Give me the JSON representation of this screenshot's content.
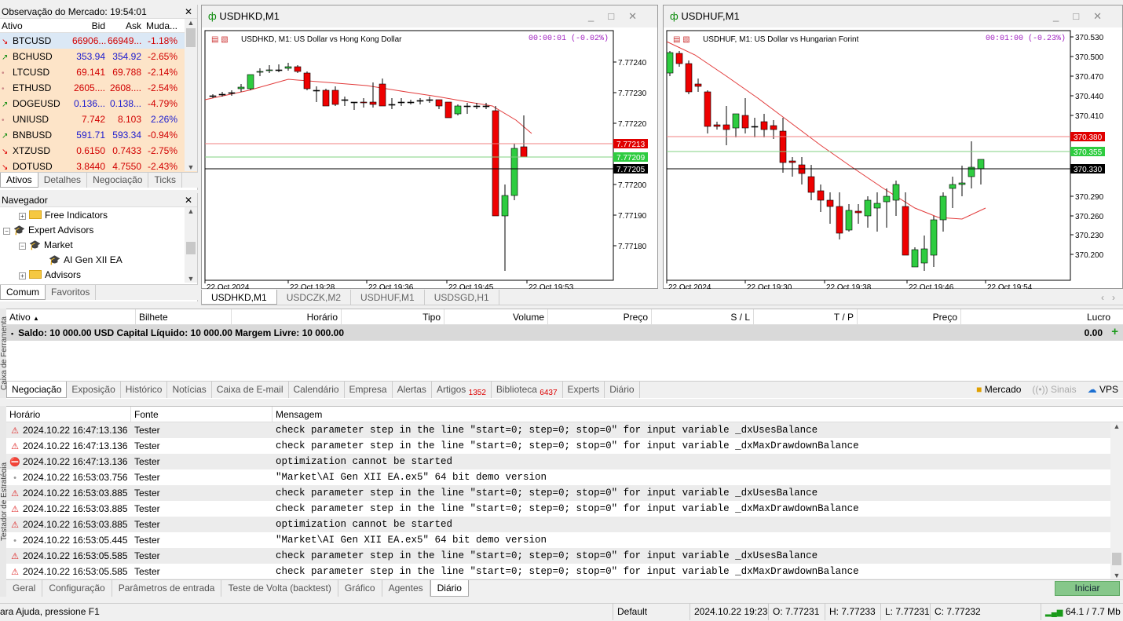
{
  "market_watch": {
    "title": "Observação do Mercado: 19:54:01",
    "headers": [
      "Ativo",
      "Bid",
      "Ask",
      "Muda..."
    ],
    "rows": [
      {
        "sym": "BTCUSD",
        "bid": "66906...",
        "ask": "66949...",
        "chg": "-1.18%",
        "dir": "dn"
      },
      {
        "sym": "BCHUSD",
        "bid": "353.94",
        "ask": "354.92",
        "chg": "-2.65%",
        "dir": "up"
      },
      {
        "sym": "LTCUSD",
        "bid": "69.141",
        "ask": "69.788",
        "chg": "-2.14%",
        "dir": "dot"
      },
      {
        "sym": "ETHUSD",
        "bid": "2605....",
        "ask": "2608....",
        "chg": "-2.54%",
        "dir": "dot"
      },
      {
        "sym": "DOGEUSD",
        "bid": "0.136...",
        "ask": "0.138...",
        "chg": "-4.79%",
        "dir": "up"
      },
      {
        "sym": "UNIUSD",
        "bid": "7.742",
        "ask": "8.103",
        "chg": "2.26%",
        "dir": "dot"
      },
      {
        "sym": "BNBUSD",
        "bid": "591.71",
        "ask": "593.34",
        "chg": "-0.94%",
        "dir": "up"
      },
      {
        "sym": "XTZUSD",
        "bid": "0.6150",
        "ask": "0.7433",
        "chg": "-2.75%",
        "dir": "dn"
      },
      {
        "sym": "DOTUSD",
        "bid": "3.8440",
        "ask": "4.7550",
        "chg": "-2.43%",
        "dir": "dn"
      }
    ],
    "tabs": [
      "Ativos",
      "Detalhes",
      "Negociação",
      "Ticks"
    ]
  },
  "navigator": {
    "title": "Navegador",
    "items": [
      "Free Indicators",
      "Expert Advisors",
      "Market",
      "AI Gen XII EA",
      "Advisors"
    ],
    "tabs": [
      "Comum",
      "Favoritos"
    ]
  },
  "chart1": {
    "title": "USDHKD,M1",
    "subtitle": "USDHKD, M1:  US Dollar vs Hong Kong Dollar",
    "timer": "00:00:01 (-0.02%)",
    "prices": [
      "7.77240",
      "7.77230",
      "7.77220",
      "7.77200",
      "7.77190",
      "7.77180"
    ],
    "lines": {
      "ask": "7.77213",
      "bid": "7.77209",
      "last": "7.77205"
    },
    "times": [
      "22 Oct 2024",
      "22 Oct 19:28",
      "22 Oct 19:36",
      "22 Oct 19:45",
      "22 Oct 19:53"
    ]
  },
  "chart2": {
    "title": "USDHUF,M1",
    "subtitle": "USDHUF, M1:  US Dollar vs Hungarian Forint",
    "timer": "00:01:00 (-0.23%)",
    "prices": [
      "370.530",
      "370.500",
      "370.470",
      "370.440",
      "370.410",
      "370.290",
      "370.260",
      "370.230",
      "370.200"
    ],
    "lines": {
      "ask": "370.380",
      "bid": "370.355",
      "last": "370.330"
    },
    "times": [
      "22 Oct 2024",
      "22 Oct 19:30",
      "22 Oct 19:38",
      "22 Oct 19:46",
      "22 Oct 19:54"
    ]
  },
  "chart_tabs": [
    "USDHKD,M1",
    "USDCZK,M2",
    "USDHUF,M1",
    "USDSGD,H1"
  ],
  "trade": {
    "headers": [
      "Ativo",
      "Bilhete",
      "Horário",
      "Tipo",
      "Volume",
      "Preço",
      "S / L",
      "T / P",
      "Preço",
      "Lucro"
    ],
    "balance": "Saldo: 10 000.00 USD  Capital Líquido: 10 000.00  Margem Livre: 10 000.00",
    "profit": "0.00",
    "side_label": "Caixa de Ferramenta"
  },
  "toolbox_tabs": {
    "items": [
      "Negociação",
      "Exposição",
      "Histórico",
      "Notícias",
      "Caixa de E-mail",
      "Calendário",
      "Empresa",
      "Alertas",
      "Artigos",
      "Biblioteca",
      "Experts",
      "Diário"
    ],
    "artigos_count": "1352",
    "biblioteca_count": "6437",
    "right": [
      "Mercado",
      "Sinais",
      "VPS"
    ]
  },
  "journal": {
    "headers": [
      "Horário",
      "Fonte",
      "Mensagem"
    ],
    "rows": [
      {
        "icon": "warn",
        "time": "2024.10.22 16:47:13.136",
        "src": "Tester",
        "msg": "check parameter step in the line \"start=0; step=0; stop=0\" for input variable _dxUsesBalance"
      },
      {
        "icon": "warn",
        "time": "2024.10.22 16:47:13.136",
        "src": "Tester",
        "msg": "check parameter step in the line \"start=0; step=0; stop=0\" for input variable _dxMaxDrawdownBalance"
      },
      {
        "icon": "err",
        "time": "2024.10.22 16:47:13.136",
        "src": "Tester",
        "msg": "optimization cannot be started"
      },
      {
        "icon": "info",
        "time": "2024.10.22 16:53:03.756",
        "src": "Tester",
        "msg": "\"Market\\AI Gen XII EA.ex5\" 64 bit demo version"
      },
      {
        "icon": "warn",
        "time": "2024.10.22 16:53:03.885",
        "src": "Tester",
        "msg": "check parameter step in the line \"start=0; step=0; stop=0\" for input variable _dxUsesBalance"
      },
      {
        "icon": "warn",
        "time": "2024.10.22 16:53:03.885",
        "src": "Tester",
        "msg": "check parameter step in the line \"start=0; step=0; stop=0\" for input variable _dxMaxDrawdownBalance"
      },
      {
        "icon": "warn",
        "time": "2024.10.22 16:53:03.885",
        "src": "Tester",
        "msg": "optimization cannot be started"
      },
      {
        "icon": "info",
        "time": "2024.10.22 16:53:05.445",
        "src": "Tester",
        "msg": "\"Market\\AI Gen XII EA.ex5\" 64 bit demo version"
      },
      {
        "icon": "warn",
        "time": "2024.10.22 16:53:05.585",
        "src": "Tester",
        "msg": "check parameter step in the line \"start=0; step=0; stop=0\" for input variable _dxUsesBalance"
      },
      {
        "icon": "warn",
        "time": "2024.10.22 16:53:05.585",
        "src": "Tester",
        "msg": "check parameter step in the line \"start=0; step=0; stop=0\" for input variable _dxMaxDrawdownBalance"
      }
    ],
    "side_label": "Testador de Estratégia"
  },
  "tester_tabs": [
    "Geral",
    "Configuração",
    "Parâmetros de entrada",
    "Teste de Volta (backtest)",
    "Gráfico",
    "Agentes",
    "Diário"
  ],
  "start_button": "Iniciar",
  "status": {
    "help": "ara Ajuda, pressione F1",
    "profile": "Default",
    "datetime": "2024.10.22 19:23",
    "open": "O: 7.77231",
    "high": "H: 7.77233",
    "low": "L: 7.77231",
    "close": "C: 7.77232",
    "traffic": "64.1 / 7.7 Mb"
  }
}
